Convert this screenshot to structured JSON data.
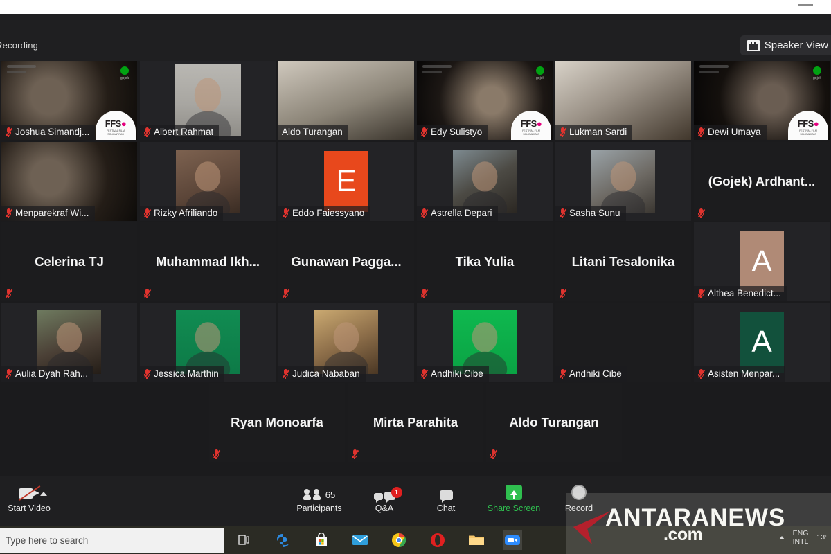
{
  "window": {
    "recording_label": "Recording",
    "view_button_label": "Speaker View",
    "view_icon": "grid-view-icon",
    "minimize_icon": "minimize-icon"
  },
  "grid": {
    "active_speaker_color": "#c8e23b",
    "rows": [
      [
        {
          "name": "Joshua Simandj...",
          "kind": "webcam",
          "muted": true,
          "watermark": "ffs",
          "gojek": true
        },
        {
          "name": "Albert Rahmat",
          "kind": "photo",
          "muted": true
        },
        {
          "name": "Aldo Turangan",
          "kind": "webcam",
          "muted": false,
          "active": true
        },
        {
          "name": "Edy Sulistyo",
          "kind": "webcam",
          "muted": true,
          "watermark": "ffs",
          "gojek": true
        },
        {
          "name": "Lukman Sardi",
          "kind": "webcam",
          "muted": true
        },
        {
          "name": "Dewi Umaya",
          "kind": "webcam",
          "muted": true,
          "watermark": "ffs",
          "gojek": true
        }
      ],
      [
        {
          "name": "Menparekraf Wi...",
          "kind": "webcam",
          "muted": true
        },
        {
          "name": "Rizky Afriliando",
          "kind": "photo",
          "muted": true
        },
        {
          "name": "Eddo Faiessyano",
          "kind": "avatar",
          "letter": "E",
          "avatar_color": "#e8481c",
          "muted": true
        },
        {
          "name": "Astrella Depari",
          "kind": "photo",
          "muted": true
        },
        {
          "name": "Sasha Sunu",
          "kind": "photo",
          "muted": true
        },
        {
          "name": "(Gojek)  Ardhant...",
          "kind": "name-only",
          "muted": true
        }
      ],
      [
        {
          "name": "Celerina TJ",
          "kind": "name-only",
          "muted": true
        },
        {
          "name": "Muhammad  Ikh...",
          "kind": "name-only",
          "muted": true
        },
        {
          "name": "Gunawan  Pagga...",
          "kind": "name-only",
          "muted": true
        },
        {
          "name": "Tika Yulia",
          "kind": "name-only",
          "muted": true
        },
        {
          "name": "Litani Tesalonika",
          "kind": "name-only",
          "muted": true
        },
        {
          "name": "Althea Benedict...",
          "kind": "avatar",
          "letter": "A",
          "avatar_color": "#b08a76",
          "muted": true
        }
      ],
      [
        {
          "name": "Aulia Dyah Rah...",
          "kind": "photo",
          "muted": true
        },
        {
          "name": "Jessica Marthin",
          "kind": "photo",
          "muted": true
        },
        {
          "name": "Judica Nababan",
          "kind": "photo",
          "muted": true
        },
        {
          "name": "Andhiki Cibe",
          "kind": "photo",
          "muted": true
        },
        {
          "name": "Andhiki Cibe",
          "kind": "blank",
          "muted": true
        },
        {
          "name": "Asisten Menpar...",
          "kind": "avatar",
          "letter": "A",
          "avatar_color": "#12513c",
          "muted": true
        }
      ],
      [
        {
          "name": "Ryan Monoarfa",
          "kind": "name-only",
          "muted": true
        },
        {
          "name": "Mirta Parahita",
          "kind": "name-only",
          "muted": true
        },
        {
          "name": "Aldo Turangan",
          "kind": "name-only",
          "muted": true
        }
      ]
    ]
  },
  "toolbar": {
    "start_video": {
      "label": "Start Video",
      "icon": "camera-off-icon",
      "caret": "chevron-up-icon"
    },
    "participants": {
      "label": "Participants",
      "count": "65",
      "icon": "people-icon"
    },
    "qa": {
      "label": "Q&A",
      "icon": "qa-bubbles-icon",
      "badge": "1"
    },
    "chat": {
      "label": "Chat",
      "icon": "chat-bubble-icon"
    },
    "share_screen": {
      "label": "Share Screen",
      "icon": "share-screen-icon",
      "color": "#2fbf4f"
    },
    "record": {
      "label": "Record",
      "icon": "record-circle-icon"
    }
  },
  "watermark": {
    "brand": "ANTARANEWS",
    "suffix": ".com",
    "arrow_color": "#b5202c"
  },
  "taskbar": {
    "search_placeholder": "Type here to search",
    "icons": [
      {
        "name": "task-view-icon"
      },
      {
        "name": "edge-icon"
      },
      {
        "name": "microsoft-store-icon"
      },
      {
        "name": "mail-icon"
      },
      {
        "name": "chrome-icon"
      },
      {
        "name": "opera-icon"
      },
      {
        "name": "file-explorer-icon"
      },
      {
        "name": "zoom-icon"
      }
    ],
    "tray": {
      "caret": "show-hidden-icons",
      "lang_line1": "ENG",
      "lang_line2": "INTL",
      "clock_line1": "13:",
      "clock_line2": ""
    }
  }
}
